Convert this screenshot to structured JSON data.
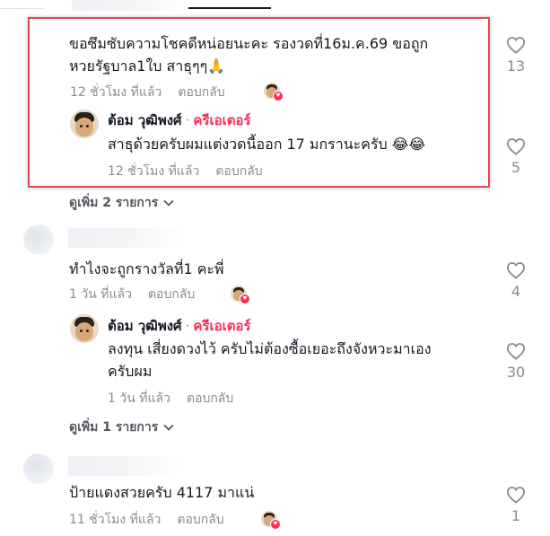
{
  "comments": [
    {
      "text_line1": "ขอซึมซับความโชคดีหน่อยนะคะ รองวดที่16ม.ค.69 ขอถูก",
      "text_line2": "หวยรัฐบาล1ใบ สาธุๆๆ🙏",
      "time": "12 ชั่วโมง ที่แล้ว",
      "reply_label": "ตอบกลับ",
      "likes": "13",
      "reply": {
        "author": "ต้อม วุฒิพงศ์",
        "separator": "·",
        "badge": "ครีเอเตอร์",
        "text_line1": "สาธุด้วยครับผมแต่งวดนี้ออก 17 มกรานะครับ 😂😂",
        "time": "12 ชั่วโมง ที่แล้ว",
        "reply_label": "ตอบกลับ",
        "likes": "5"
      },
      "view_more": "ดูเพิ่ม 2 รายการ"
    },
    {
      "text_line1": "ทำไงจะถูกรางวัลที่1 คะพี่",
      "time": "1 วัน ที่แล้ว",
      "reply_label": "ตอบกลับ",
      "likes": "4",
      "reply": {
        "author": "ต้อม วุฒิพงศ์",
        "separator": "·",
        "badge": "ครีเอเตอร์",
        "text_line1": "ลงทุน เสี่ยงดวงไว้ ครับไม่ต้องซื้อเยอะถึงจังหวะมาเอง",
        "text_line2": "ครับผม",
        "time": "1 วัน ที่แล้ว",
        "reply_label": "ตอบกลับ",
        "likes": "30"
      },
      "view_more": "ดูเพิ่ม 1 รายการ"
    },
    {
      "text_line1": "ป้ายแดงสวยครับ 4117 มาแน่",
      "time": "11 ชั่วโมง ที่แล้ว",
      "reply_label": "ตอบกลับ",
      "likes": "1"
    }
  ],
  "icons": {
    "like": "heart-outline-icon",
    "chevron": "chevron-down-icon",
    "creator_liked": "creator-liked-heart-icon"
  },
  "colors": {
    "creator": "#fe2c55",
    "highlight": "#e5474b",
    "muted": "#8a8b91"
  }
}
